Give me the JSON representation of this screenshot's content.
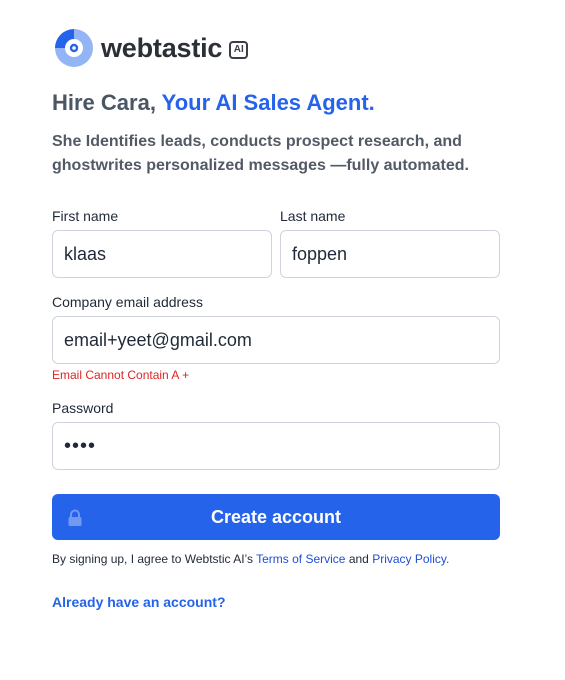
{
  "brand": {
    "name": "webtastic",
    "badge": "AI",
    "logo_icon": "webtastic-logo-icon",
    "colors": {
      "logo_primary": "#2563eb",
      "logo_secondary": "#93b4f5"
    }
  },
  "hero": {
    "headline_prefix": "Hire Cara, ",
    "headline_accent": "Your AI Sales Agent.",
    "subtitle": "She Identifies leads, conducts prospect research, and ghostwrites personalized messages —fully automated."
  },
  "form": {
    "first_name": {
      "label": "First name",
      "value": "klaas"
    },
    "last_name": {
      "label": "Last name",
      "value": "foppen"
    },
    "email": {
      "label": "Company email address",
      "value": "email+yeet@gmail.com",
      "error": "Email Cannot Contain A +"
    },
    "password": {
      "label": "Password",
      "value": "abcd"
    },
    "submit": {
      "label": "Create account",
      "icon": "lock-icon"
    }
  },
  "legal": {
    "prefix": "By signing up, I agree to Webtstic AI’s ",
    "terms_link": "Terms of Service",
    "joiner": " and ",
    "privacy_link": "Privacy Policy."
  },
  "signin": {
    "link": "Already have an account?"
  },
  "colors": {
    "accent": "#2563eb",
    "error": "#dc2626",
    "heading_gray": "#4b5563",
    "border": "#cfd4dc"
  }
}
